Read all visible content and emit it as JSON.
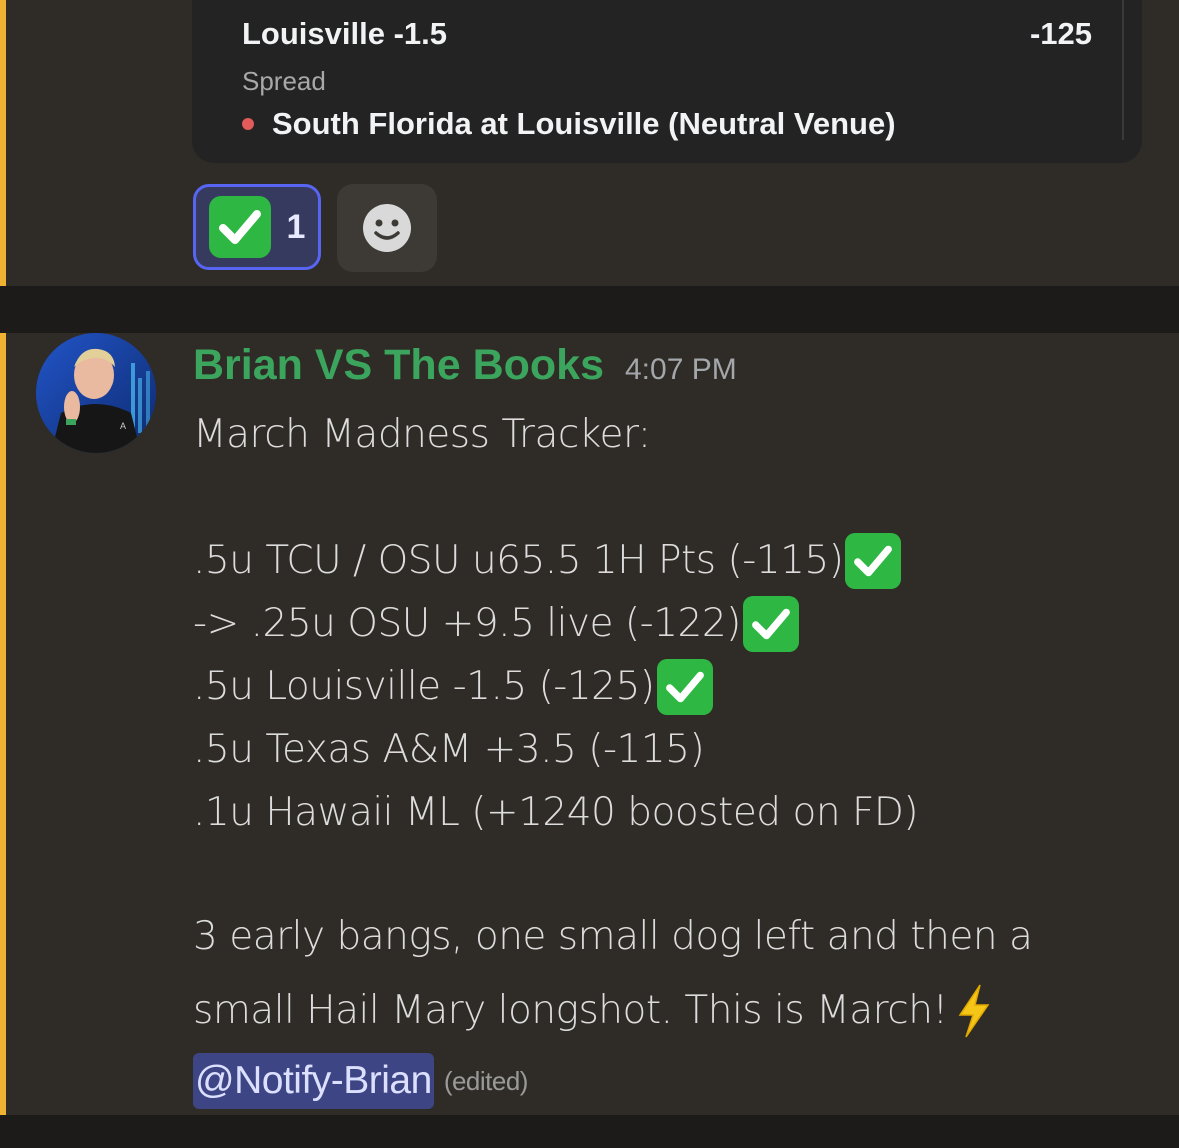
{
  "embed": {
    "bet_title": "Louisville -1.5",
    "bet_odds": "-125",
    "bet_type": "Spread",
    "game": "South Florida at Louisville (Neutral Venue)"
  },
  "reactions": [
    {
      "emoji": "white-check-mark",
      "count": "1",
      "selected": true
    }
  ],
  "message": {
    "author": "Brian VS The Books",
    "author_color": "#3ba55d",
    "timestamp": "4:07 PM",
    "title_line": "March Madness Tracker:",
    "bets": [
      {
        "text": ".5u TCU / OSU u65.5 1H Pts (-115)",
        "check": true
      },
      {
        "text": "-> .25u OSU +9.5 live (-122)",
        "check": true
      },
      {
        "text": ".5u Louisville -1.5 (-125)",
        "check": true
      },
      {
        "text": ".5u Texas A&M +3.5 (-115)",
        "check": false
      },
      {
        "text": ".1u Hawaii ML (+1240 boosted on FD)",
        "check": false
      }
    ],
    "closing_line_1": "3 early bangs, one small dog left and then a",
    "closing_line_2": "small Hail Mary longshot. This is March!",
    "mention": "@Notify-Brian",
    "edited": "(edited)"
  },
  "colors": {
    "highlight": "#f0b232",
    "check_green": "#2eb843",
    "mention_bg": "#3e4584",
    "reaction_border": "#5865f2"
  }
}
